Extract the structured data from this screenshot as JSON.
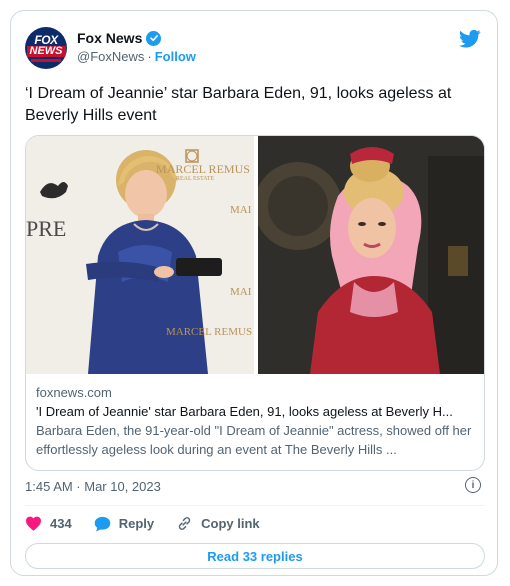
{
  "account": {
    "name": "Fox News",
    "handle": "@FoxNews",
    "separator": "·",
    "follow_label": "Follow",
    "avatar_text_top": "FOX",
    "avatar_text_bottom": "NEWS"
  },
  "tweet": {
    "text": "‘I Dream of Jeannie’ star Barbara Eden, 91, looks ageless at Beverly Hills event"
  },
  "link_card": {
    "photo_left_backdrop": {
      "brand": "MARCEL REMUS",
      "brand_sub": "REAL ESTATE",
      "pre": "PRE",
      "mai": "MAI"
    },
    "domain": "foxnews.com",
    "title": "'I Dream of Jeannie' star Barbara Eden, 91, looks ageless at Beverly H...",
    "description": "Barbara Eden, the 91-year-old \"I Dream of Jeannie\" actress, showed off her effortlessly ageless look during an event at The Beverly Hills ..."
  },
  "timestamp": "1:45 AM · Mar 10, 2023",
  "actions": {
    "like_count": "434",
    "reply_label": "Reply",
    "copy_label": "Copy link"
  },
  "read_replies_label": "Read 33 replies",
  "colors": {
    "accent": "#1d9bf0",
    "like": "#f91880",
    "text_secondary": "#536471",
    "border": "#cfd9de"
  },
  "icons": {
    "bird": "twitter-bird-icon",
    "verified": "verified-badge-icon",
    "info": "info-icon",
    "heart": "heart-icon",
    "reply": "reply-bubble-icon",
    "link": "link-icon"
  }
}
